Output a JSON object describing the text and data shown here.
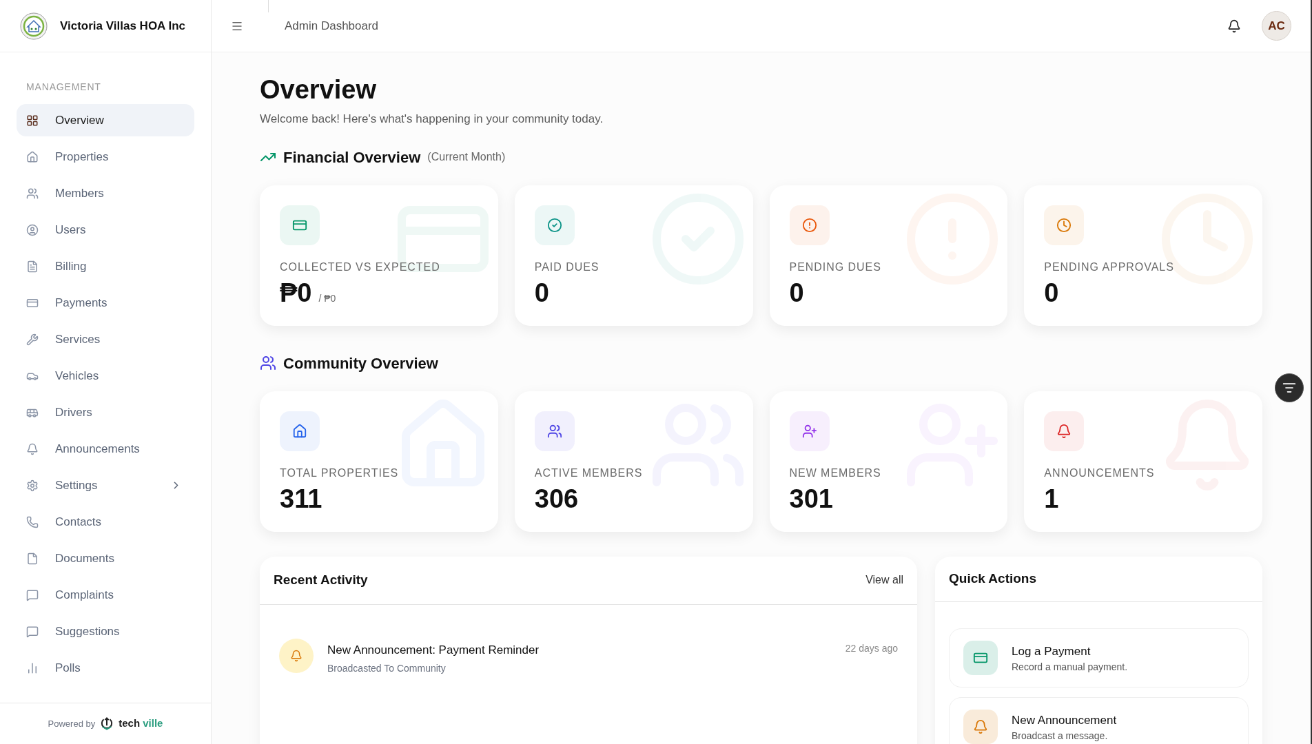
{
  "sidebar": {
    "org_name": "Victoria Villas HOA Inc",
    "section_label": "MANAGEMENT",
    "items": [
      {
        "label": "Overview",
        "selected": true,
        "submenu": false
      },
      {
        "label": "Properties",
        "selected": false,
        "submenu": false
      },
      {
        "label": "Members",
        "selected": false,
        "submenu": false
      },
      {
        "label": "Users",
        "selected": false,
        "submenu": false
      },
      {
        "label": "Billing",
        "selected": false,
        "submenu": false
      },
      {
        "label": "Payments",
        "selected": false,
        "submenu": false
      },
      {
        "label": "Services",
        "selected": false,
        "submenu": false
      },
      {
        "label": "Vehicles",
        "selected": false,
        "submenu": false
      },
      {
        "label": "Drivers",
        "selected": false,
        "submenu": false
      },
      {
        "label": "Announcements",
        "selected": false,
        "submenu": false
      },
      {
        "label": "Settings",
        "selected": false,
        "submenu": true
      },
      {
        "label": "Contacts",
        "selected": false,
        "submenu": false
      },
      {
        "label": "Documents",
        "selected": false,
        "submenu": false
      },
      {
        "label": "Complaints",
        "selected": false,
        "submenu": false
      },
      {
        "label": "Suggestions",
        "selected": false,
        "submenu": false
      },
      {
        "label": "Polls",
        "selected": false,
        "submenu": false
      }
    ],
    "footer": {
      "powered_by": "Powered by",
      "brand_words": [
        "tech",
        "ville"
      ]
    }
  },
  "header": {
    "title": "Admin Dashboard",
    "avatar": "AC"
  },
  "page": {
    "title": "Overview",
    "subtitle": "Welcome back! Here's what's happening in your community today."
  },
  "financial": {
    "title": "Financial Overview",
    "note": "(Current Month)",
    "cards": [
      {
        "label": "COLLECTED VS EXPECTED",
        "value": "₱0",
        "secondary": "/ ₱0",
        "color": "#059669"
      },
      {
        "label": "PAID DUES",
        "value": "0",
        "color": "#0d9488"
      },
      {
        "label": "PENDING DUES",
        "value": "0",
        "color": "#ea580c"
      },
      {
        "label": "PENDING APPROVALS",
        "value": "0",
        "color": "#d97706"
      }
    ]
  },
  "community": {
    "title": "Community Overview",
    "cards": [
      {
        "label": "TOTAL PROPERTIES",
        "value": "311",
        "color": "#2563eb"
      },
      {
        "label": "ACTIVE MEMBERS",
        "value": "306",
        "color": "#4f46e5"
      },
      {
        "label": "NEW MEMBERS",
        "value": "301",
        "color": "#9333ea"
      },
      {
        "label": "ANNOUNCEMENTS",
        "value": "1",
        "color": "#dc2626"
      }
    ]
  },
  "recent_activity": {
    "title": "Recent Activity",
    "link": "View all",
    "items": [
      {
        "title": "New Announcement: Payment Reminder",
        "subtitle": "Broadcasted To Community",
        "time": "22 days ago"
      }
    ]
  },
  "quick_actions": {
    "title": "Quick Actions",
    "items": [
      {
        "title": "Log a Payment",
        "subtitle": "Record a manual payment.",
        "color": "#059669"
      },
      {
        "title": "New Announcement",
        "subtitle": "Broadcast a message.",
        "color": "#d97706"
      }
    ]
  }
}
